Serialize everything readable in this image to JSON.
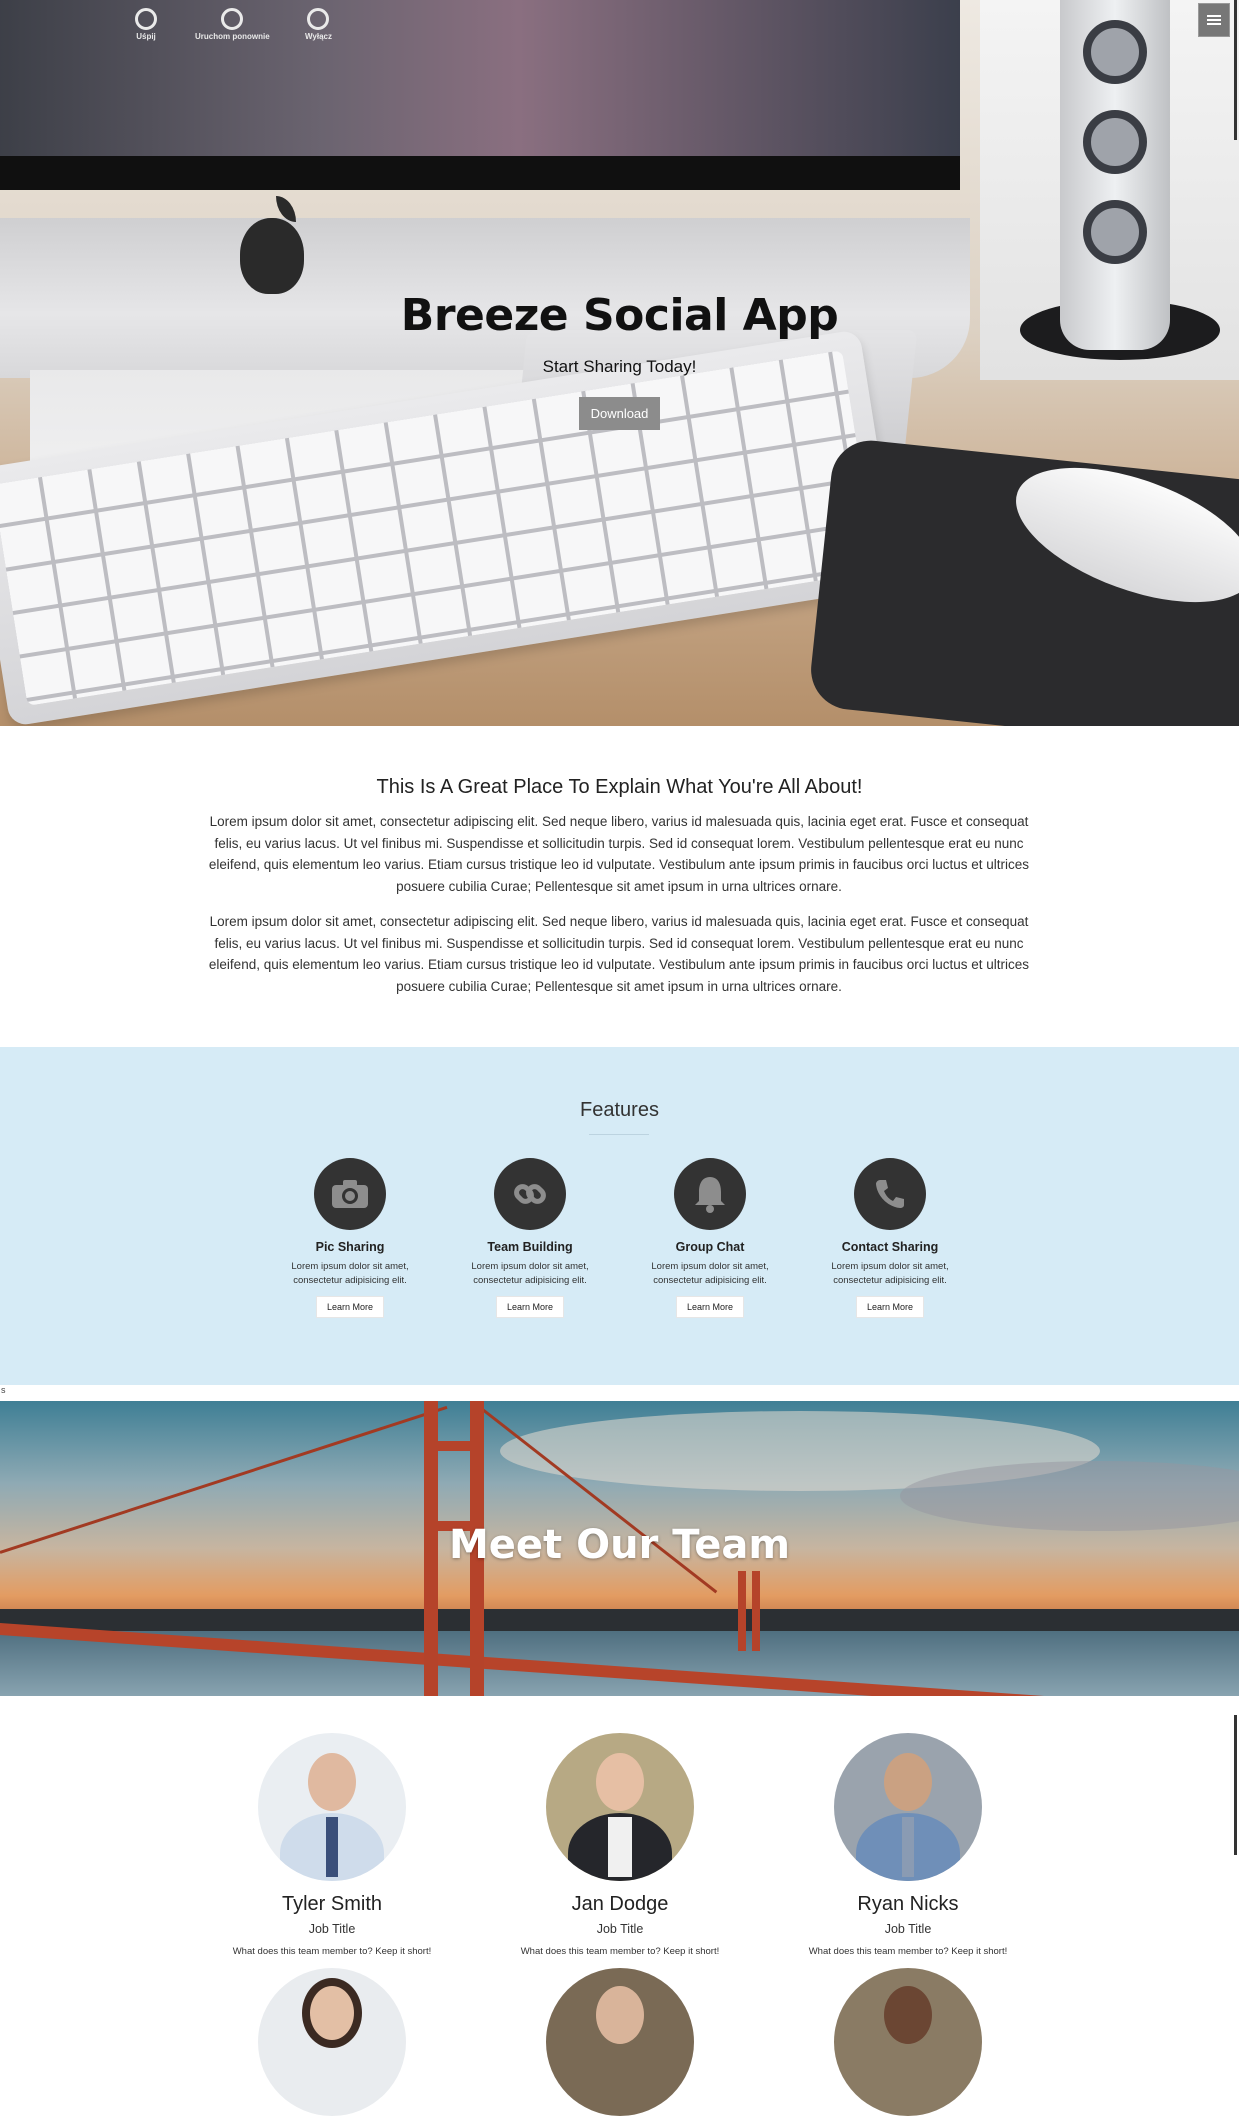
{
  "hero": {
    "title": "Breeze Social App",
    "subtitle": "Start Sharing Today!",
    "download_label": "Download",
    "screen_icons": [
      "Uśpij",
      "Uruchom ponownie",
      "Wyłącz"
    ]
  },
  "nav": {
    "menu_icon": "hamburger-icon"
  },
  "about": {
    "title": "This Is A Great Place To Explain What You're All About!",
    "paragraphs": [
      "Lorem ipsum dolor sit amet, consectetur adipiscing elit. Sed neque libero, varius id malesuada quis, lacinia eget erat. Fusce et consequat felis, eu varius lacus. Ut vel finibus mi. Suspendisse et sollicitudin turpis. Sed id consequat lorem. Vestibulum pellentesque erat eu nunc eleifend, quis elementum leo varius. Etiam cursus tristique leo id vulputate. Vestibulum ante ipsum primis in faucibus orci luctus et ultrices posuere cubilia Curae; Pellentesque sit amet ipsum in urna ultrices ornare.",
      "Lorem ipsum dolor sit amet, consectetur adipiscing elit. Sed neque libero, varius id malesuada quis, lacinia eget erat. Fusce et consequat felis, eu varius lacus. Ut vel finibus mi. Suspendisse et sollicitudin turpis. Sed id consequat lorem. Vestibulum pellentesque erat eu nunc eleifend, quis elementum leo varius. Etiam cursus tristique leo id vulputate. Vestibulum ante ipsum primis in faucibus orci luctus et ultrices posuere cubilia Curae; Pellentesque sit amet ipsum in urna ultrices ornare."
    ]
  },
  "features": {
    "title": "Features",
    "items": [
      {
        "icon": "camera-icon",
        "name": "Pic Sharing",
        "desc": "Lorem ipsum dolor sit amet, consectetur adipisicing elit.",
        "button": "Learn More"
      },
      {
        "icon": "link-icon",
        "name": "Team Building",
        "desc": "Lorem ipsum dolor sit amet, consectetur adipisicing elit.",
        "button": "Learn More"
      },
      {
        "icon": "bell-icon",
        "name": "Group Chat",
        "desc": "Lorem ipsum dolor sit amet, consectetur adipisicing elit.",
        "button": "Learn More"
      },
      {
        "icon": "phone-icon",
        "name": "Contact Sharing",
        "desc": "Lorem ipsum dolor sit amet, consectetur adipisicing elit.",
        "button": "Learn More"
      }
    ]
  },
  "stray_char": "s",
  "team": {
    "title": "Meet Our Team",
    "members": [
      {
        "name": "Tyler Smith",
        "title": "Job Title",
        "desc": "What does this team member to? Keep it short!"
      },
      {
        "name": "Jan Dodge",
        "title": "Job Title",
        "desc": "What does this team member to? Keep it short!"
      },
      {
        "name": "Ryan Nicks",
        "title": "Job Title",
        "desc": "What does this team member to? Keep it short!"
      }
    ]
  },
  "colors": {
    "features_bg": "#d6ebf6",
    "icon_circle": "#333333",
    "download_button": "#8c8c8c"
  }
}
